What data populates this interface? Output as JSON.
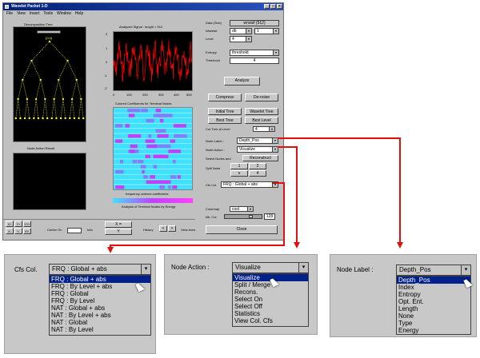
{
  "window": {
    "title": "Wavelet Packet 1-D",
    "menu": [
      "File",
      "View",
      "Insert",
      "Tools",
      "Window",
      "Help"
    ]
  },
  "left_panels": {
    "tree_title": "Decomposition Tree",
    "tree_label": "(0,0)",
    "node_action_result_title": "Node Action Result"
  },
  "center_panels": {
    "signal_title": "Analyzed Signal : length = 512",
    "coef_title": "Colored Coefficients for Terminal Nodes",
    "freq_caption": "frequency ordered coefficients",
    "energy_caption": "Analysis of Terminal Nodes by Energy",
    "y_ticks": [
      "2",
      "1",
      "0",
      "-1",
      "-2"
    ],
    "x_ticks": [
      "0",
      "100",
      "200",
      "300",
      "400",
      "500"
    ]
  },
  "right_controls": {
    "data_size_label": "Data (Size)",
    "data_value": "wnoisf (512)",
    "wavelet_label": "Wavelet",
    "wavelet_value": "db",
    "wavelet_num": "1",
    "level_label": "Level",
    "level_value": "4",
    "entropy_label": "Entropy",
    "entropy_value": "threshold",
    "threshold_label": "Threshold",
    "threshold_value": "4",
    "analyze_btn": "Analyze",
    "compress_btn": "Compress",
    "denoise_btn": "De-noise",
    "initial_tree_btn": "Initial Tree",
    "wavelet_tree_btn": "Wavelet Tree",
    "best_tree_btn": "Best Tree",
    "best_level_btn": "Best Level",
    "cut_tree_label": "Cut Tree at Level",
    "cut_tree_value": "4",
    "node_label_label": "Node Label :",
    "node_label_value": "Depth_Pos",
    "node_action_label": "Node Action :",
    "node_action_value": "Visualize",
    "select_nodes_label": "Select Nodes and",
    "reconstruct_btn": "Reconstruct",
    "split_label": "Split Node",
    "split_1": "1",
    "split_2": "2",
    "cfs_col_label": "Cfs Col.",
    "cfs_col_value": "FRQ : Global + abs",
    "colormap_label": "Colormap",
    "colormap_value": "cool",
    "nb_colors_label": "Nb. Col.",
    "nb_colors_value": "128",
    "close_btn": "Close"
  },
  "bottom_toolbar": {
    "center_on": "Center On",
    "info": "Info",
    "x_btn": "X+",
    "y_btn": "Y+",
    "x_minus": "X-",
    "y_minus": "Y-",
    "history": "History",
    "view_axes": "View Axes"
  },
  "callouts": {
    "cfs": {
      "label": "Cfs Col.",
      "value": "FRQ : Global + abs",
      "items": [
        "FRQ : Global + abs",
        "FRQ : By Level + abs",
        "FRQ : Global",
        "FRQ : By Level",
        "NAT : Global + abs",
        "NAT : By Level + abs",
        "NAT : Global",
        "NAT : By Level"
      ]
    },
    "action": {
      "label": "Node Action :",
      "value": "Visualize",
      "items": [
        "Visualize",
        "Split / Merge",
        "Recons.",
        "Select On",
        "Select Off",
        "Statistics",
        "View Col. Cfs"
      ]
    },
    "nodelabel": {
      "label": "Node Label :",
      "value": "Depth_Pos",
      "items": [
        "Depth_Pos",
        "Index",
        "Entropy",
        "Opt. Ent.",
        "Length",
        "None",
        "Type",
        "Energy"
      ]
    }
  },
  "colors": {
    "signal": "#ff0000",
    "coef_base": "#40e0ff",
    "coef_accent": "#c040ff",
    "highlight": "#00208a",
    "arrow": "#e01010"
  }
}
